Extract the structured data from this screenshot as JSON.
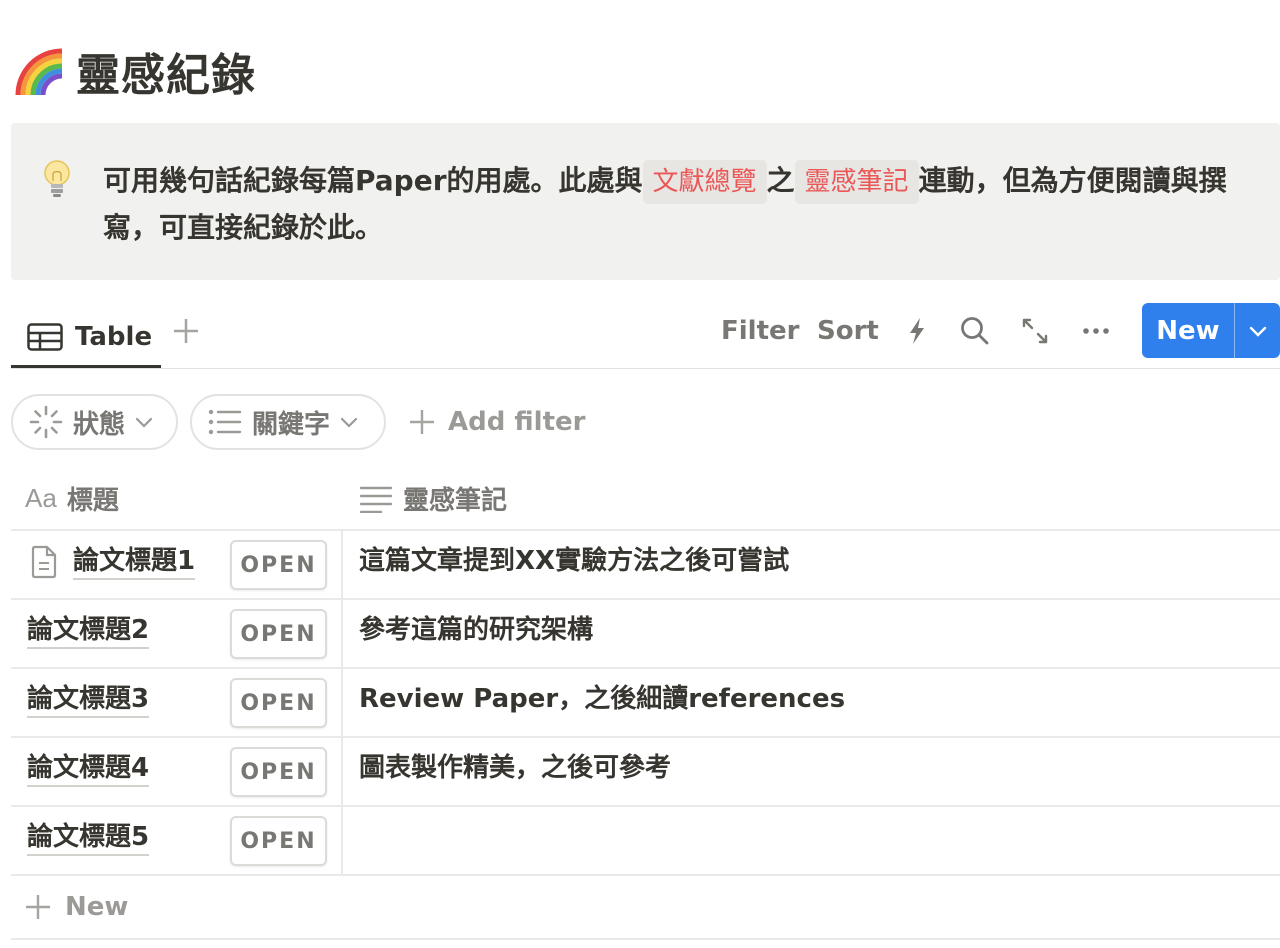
{
  "page": {
    "title": "靈感紀錄",
    "icon": "rainbow-icon"
  },
  "callout": {
    "icon": "lightbulb-icon",
    "text_before": "可用幾句話紀錄每篇Paper的用處。此處與",
    "code1": "文獻總覽",
    "text_middle": "之",
    "code2": "靈感筆記",
    "text_after": "連動，但為方便閱讀與撰寫，可直接紀錄於此。"
  },
  "viewbar": {
    "tab_label": "Table",
    "filter_label": "Filter",
    "sort_label": "Sort",
    "new_label": "New"
  },
  "filters": {
    "chip1_label": "狀態",
    "chip2_label": "關鍵字",
    "add_filter_label": "Add filter"
  },
  "table": {
    "columns": [
      {
        "icon": "Aa",
        "label": "標題"
      },
      {
        "icon": "text-lines-icon",
        "label": "靈感筆記"
      }
    ],
    "open_label": "OPEN",
    "rows": [
      {
        "title": "論文標題1",
        "note": "這篇文章提到XX實驗方法之後可嘗試",
        "has_doc_icon": true
      },
      {
        "title": "論文標題2",
        "note": "參考這篇的研究架構"
      },
      {
        "title": "論文標題3",
        "note": "Review Paper，之後細讀references"
      },
      {
        "title": "論文標題4",
        "note": "圖表製作精美，之後可參考"
      },
      {
        "title": "論文標題5",
        "note": ""
      }
    ],
    "new_row_label": "New"
  },
  "colors": {
    "accent": "#2f80ed",
    "code_text": "#eb5757",
    "callout_bg": "#f1f1ef",
    "text": "#37352f",
    "muted": "#787774"
  }
}
